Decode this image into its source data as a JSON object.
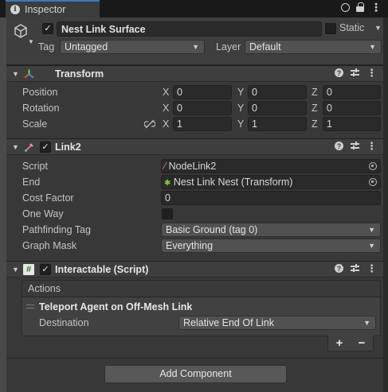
{
  "tab": {
    "title": "Inspector"
  },
  "object": {
    "name": "Nest Link Surface",
    "active": true,
    "static_label": "Static",
    "static_checked": false,
    "tag_label": "Tag",
    "tag_value": "Untagged",
    "layer_label": "Layer",
    "layer_value": "Default"
  },
  "transform": {
    "title": "Transform",
    "rows": [
      {
        "label": "Position",
        "x": "0",
        "y": "0",
        "z": "0"
      },
      {
        "label": "Rotation",
        "x": "0",
        "y": "0",
        "z": "0"
      },
      {
        "label": "Scale",
        "x": "1",
        "y": "1",
        "z": "1"
      }
    ],
    "axes": {
      "x": "X",
      "y": "Y",
      "z": "Z"
    }
  },
  "link2": {
    "title": "Link2",
    "enabled": true,
    "script_label": "Script",
    "script_value": "NodeLink2",
    "end_label": "End",
    "end_value": "Nest Link Nest (Transform)",
    "cost_label": "Cost Factor",
    "cost_value": "0",
    "oneway_label": "One Way",
    "oneway_checked": false,
    "tag_label": "Pathfinding Tag",
    "tag_value": "Basic Ground (tag 0)",
    "mask_label": "Graph Mask",
    "mask_value": "Everything"
  },
  "interactable": {
    "title": "Interactable (Script)",
    "enabled": true,
    "actions_label": "Actions",
    "item_title": "Teleport Agent on Off-Mesh Link",
    "destination_label": "Destination",
    "destination_value": "Relative End Of Link",
    "add_symbol": "+",
    "remove_symbol": "−"
  },
  "footer": {
    "add_component": "Add Component"
  },
  "colors": {
    "accent": "#3a79bb",
    "panel": "#383838",
    "field": "#2a2a2a"
  }
}
